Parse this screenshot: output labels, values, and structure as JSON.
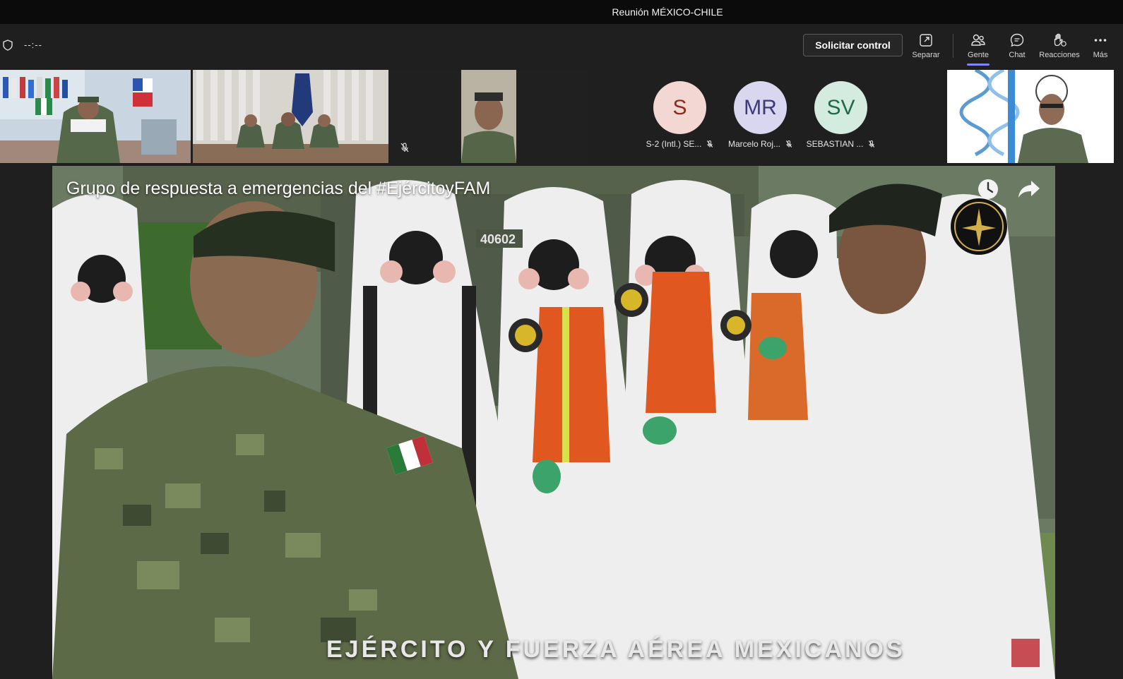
{
  "window": {
    "title": "Reunión MÉXICO-CHILE"
  },
  "toolbar": {
    "timer": "--:--",
    "request_control_label": "Solicitar control",
    "buttons": [
      {
        "label": "Separar",
        "icon": "pop-out-icon"
      },
      {
        "label": "Gente",
        "icon": "people-icon",
        "active": true
      },
      {
        "label": "Chat",
        "icon": "chat-icon"
      },
      {
        "label": "Reacciones",
        "icon": "raise-hand-icon"
      },
      {
        "label": "Más",
        "icon": "more-icon"
      }
    ],
    "accent_color": "#7f85f5"
  },
  "participants": [
    {
      "type": "video",
      "scene": "officer-desk-flags"
    },
    {
      "type": "video",
      "scene": "three-officers-table"
    },
    {
      "type": "video",
      "scene": "officer-portrait",
      "muted": true
    },
    {
      "type": "avatar",
      "initials": "S",
      "name": "S-2 (Intl.) SE...",
      "bg": "#f2d7d2",
      "fg": "#8a2b1e",
      "muted": true
    },
    {
      "type": "avatar",
      "initials": "MR",
      "name": "Marcelo Roj...",
      "bg": "#d9d6ef",
      "fg": "#3d3a7a",
      "muted": true
    },
    {
      "type": "avatar",
      "initials": "SV",
      "name": "SEBASTIAN ...",
      "bg": "#d4ece0",
      "fg": "#1f6b45",
      "muted": true
    },
    {
      "type": "video",
      "scene": "officer-dna-background"
    }
  ],
  "shared_video": {
    "title": "Grupo de respuesta a emergencias del #EjércitoyFAM",
    "caption": "EJÉRCITO Y FUERZA AÉREA MEXICANOS",
    "vehicle_number": "40602"
  }
}
